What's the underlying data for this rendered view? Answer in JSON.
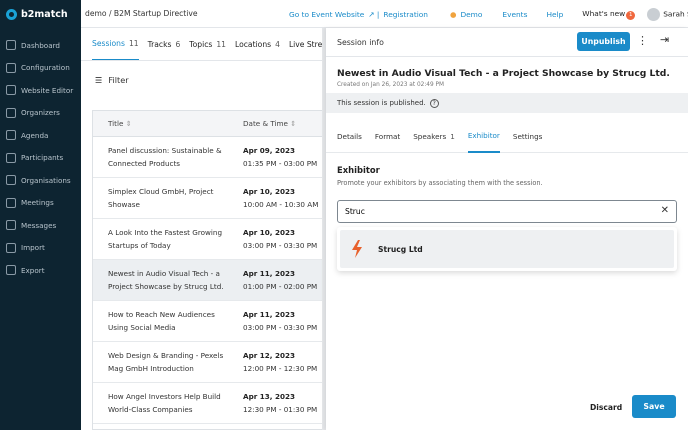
{
  "brand": "b2match",
  "breadcrumb": "demo / B2M Startup Directive",
  "topbar": {
    "event_link": "Go to Event Website",
    "registration": "Registration",
    "demo": "Demo",
    "events": "Events",
    "help": "Help",
    "whatsnew": "What's new",
    "whatsnew_count": "1",
    "user": "Sarah Smith"
  },
  "sidebar": {
    "items": [
      {
        "label": "Dashboard",
        "icon": "dashboard-icon"
      },
      {
        "label": "Configuration",
        "icon": "gear-icon"
      },
      {
        "label": "Website Editor",
        "icon": "website-icon"
      },
      {
        "label": "Organizers",
        "icon": "organizers-icon"
      },
      {
        "label": "Agenda",
        "icon": "agenda-icon"
      },
      {
        "label": "Participants",
        "icon": "participants-icon"
      },
      {
        "label": "Organisations",
        "icon": "organisations-icon"
      },
      {
        "label": "Meetings",
        "icon": "meetings-icon"
      },
      {
        "label": "Messages",
        "icon": "messages-icon"
      },
      {
        "label": "Import",
        "icon": "import-icon"
      },
      {
        "label": "Export",
        "icon": "export-icon"
      }
    ]
  },
  "tabs": [
    {
      "label": "Sessions",
      "count": "11"
    },
    {
      "label": "Tracks",
      "count": "6"
    },
    {
      "label": "Topics",
      "count": "11"
    },
    {
      "label": "Locations",
      "count": "4"
    },
    {
      "label": "Live Streams",
      "count": ""
    }
  ],
  "filter": "Filter",
  "table": {
    "headers": [
      "Title",
      "Date & Time"
    ],
    "rows": [
      {
        "title1": "Panel discussion: Sustainable &",
        "title2": "Connected Products",
        "date": "Apr 09, 2023",
        "time": "01:35 PM - 03:00 PM"
      },
      {
        "title1": "Simplex Cloud GmbH, Project",
        "title2": "Showase",
        "date": "Apr 10, 2023",
        "time": "10:00 AM - 10:30 AM"
      },
      {
        "title1": "A Look Into the Fastest Growing",
        "title2": "Startups of Today",
        "date": "Apr 10, 2023",
        "time": "03:00 PM - 03:30 PM"
      },
      {
        "title1": "Newest in Audio Visual Tech - a",
        "title2": "Project Showcase by Strucg Ltd.",
        "date": "Apr 11, 2023",
        "time": "01:00 PM - 02:00 PM"
      },
      {
        "title1": "How to Reach New Audiences",
        "title2": "Using Social Media",
        "date": "Apr 11, 2023",
        "time": "03:00 PM - 03:30 PM"
      },
      {
        "title1": "Web Design & Branding - Pexels",
        "title2": "Mag GmbH Introduction",
        "date": "Apr 12, 2023",
        "time": "12:00 PM - 12:30 PM"
      },
      {
        "title1": "How Angel Investors Help Build",
        "title2": "World-Class Companies",
        "date": "Apr 13, 2023",
        "time": "12:30 PM - 01:30 PM"
      }
    ]
  },
  "panel": {
    "header": "Session info",
    "unpublish": "Unpublish",
    "title": "Newest in Audio Visual Tech - a Project Showcase by Strucg Ltd.",
    "created": "Created on Jan 26, 2023 at 02:49 PM",
    "published": "This session is published.",
    "tabs": [
      {
        "label": "Details",
        "count": ""
      },
      {
        "label": "Format",
        "count": ""
      },
      {
        "label": "Speakers",
        "count": "1"
      },
      {
        "label": "Exhibitor",
        "count": ""
      },
      {
        "label": "Settings",
        "count": ""
      }
    ],
    "exhibitor_title": "Exhibitor",
    "exhibitor_sub": "Promote your exhibitors by associating them with the session.",
    "search_value": "Struc",
    "option": "Strucg Ltd",
    "discard": "Discard",
    "save": "Save"
  }
}
